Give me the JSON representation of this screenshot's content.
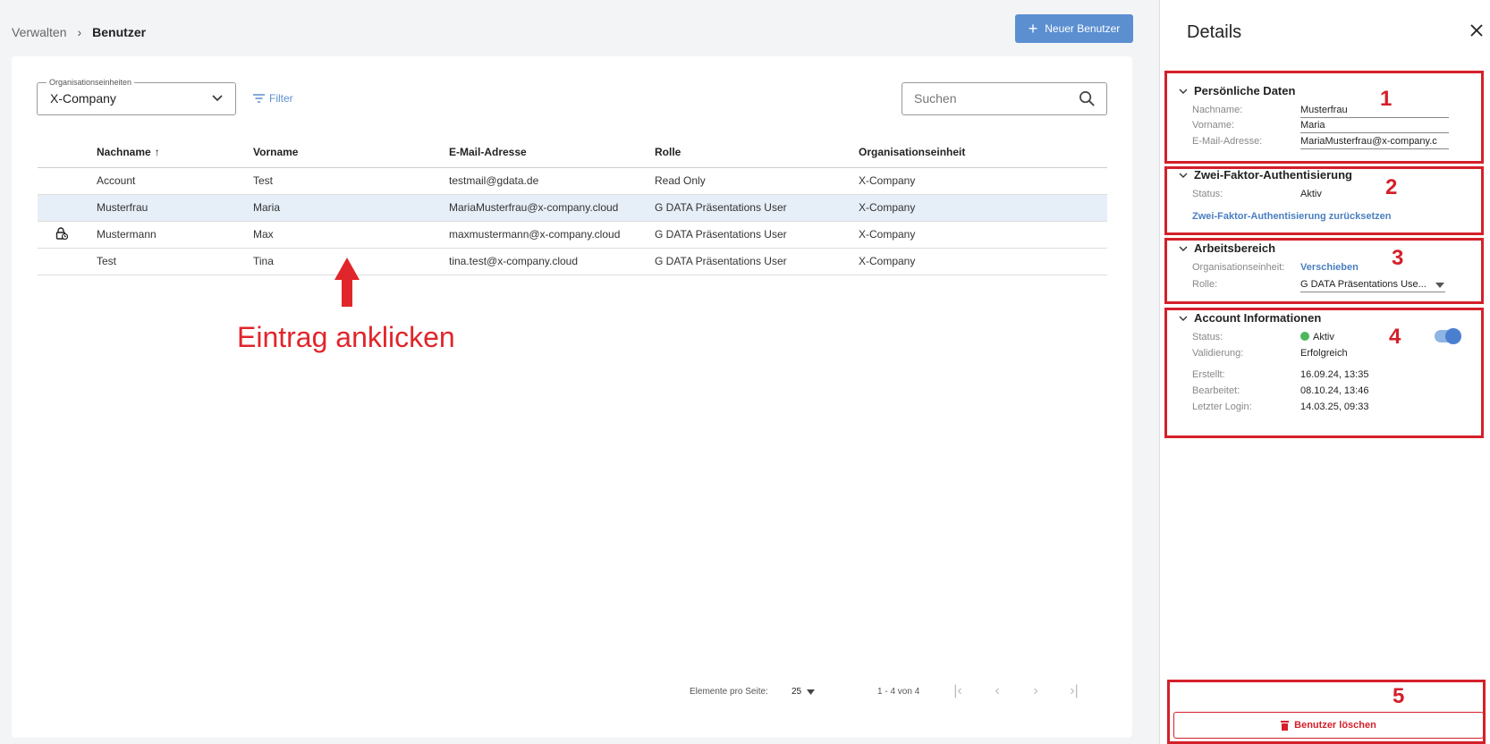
{
  "breadcrumb": {
    "parent": "Verwalten",
    "current": "Benutzer"
  },
  "actions": {
    "new_user": "Neuer Benutzer"
  },
  "filters": {
    "org_legend": "Organisationseinheiten",
    "org_value": "X-Company",
    "filter_label": "Filter",
    "search_placeholder": "Suchen"
  },
  "table": {
    "headers": [
      "Nachname",
      "Vorname",
      "E-Mail-Adresse",
      "Rolle",
      "Organisationseinheit"
    ],
    "sort_indicator": "↑",
    "rows": [
      [
        "Account",
        "Test",
        "testmail@gdata.de",
        "Read Only",
        "X-Company"
      ],
      [
        "Musterfrau",
        "Maria",
        "MariaMusterfrau@x-company.cloud",
        "G DATA Präsentations User",
        "X-Company"
      ],
      [
        "Mustermann",
        "Max",
        "maxmustermann@x-company.cloud",
        "G DATA Präsentations User",
        "X-Company"
      ],
      [
        "Test",
        "Tina",
        "tina.test@x-company.cloud",
        "G DATA Präsentations User",
        "X-Company"
      ]
    ]
  },
  "annotation": {
    "hint": "Eintrag anklicken"
  },
  "pagination": {
    "per_page_label": "Elemente pro Seite:",
    "per_page_value": "25",
    "range": "1 - 4 von 4"
  },
  "details": {
    "title": "Details",
    "personal": {
      "title": "Persönliche Daten",
      "lastname_label": "Nachname:",
      "lastname": "Musterfrau",
      "firstname_label": "Vorname:",
      "firstname": "Maria",
      "email_label": "E-Mail-Adresse:",
      "email": "MariaMusterfrau@x-company.c"
    },
    "twofa": {
      "title": "Zwei-Faktor-Authentisierung",
      "status_label": "Status:",
      "status": "Aktiv",
      "reset_link": "Zwei-Faktor-Authentisierung zurücksetzen"
    },
    "workspace": {
      "title": "Arbeitsbereich",
      "org_label": "Organisationseinheit:",
      "org_link": "Verschieben",
      "role_label": "Rolle:",
      "role": "G DATA Präsentations Use..."
    },
    "account": {
      "title": "Account Informationen",
      "status_label": "Status:",
      "status": "Aktiv",
      "validation_label": "Validierung:",
      "validation": "Erfolgreich",
      "created_label": "Erstellt:",
      "created": "16.09.24, 13:35",
      "edited_label": "Bearbeitet:",
      "edited": "08.10.24, 13:46",
      "last_login_label": "Letzter Login:",
      "last_login": "14.03.25, 09:33"
    },
    "delete_button": "Benutzer löschen"
  },
  "markers": [
    "1",
    "2",
    "3",
    "4",
    "5"
  ],
  "colors": {
    "accent": "#5b8fd0",
    "highlight": "#d4202a",
    "selected_row": "#e6eef7",
    "active_dot": "#4cb85a"
  }
}
